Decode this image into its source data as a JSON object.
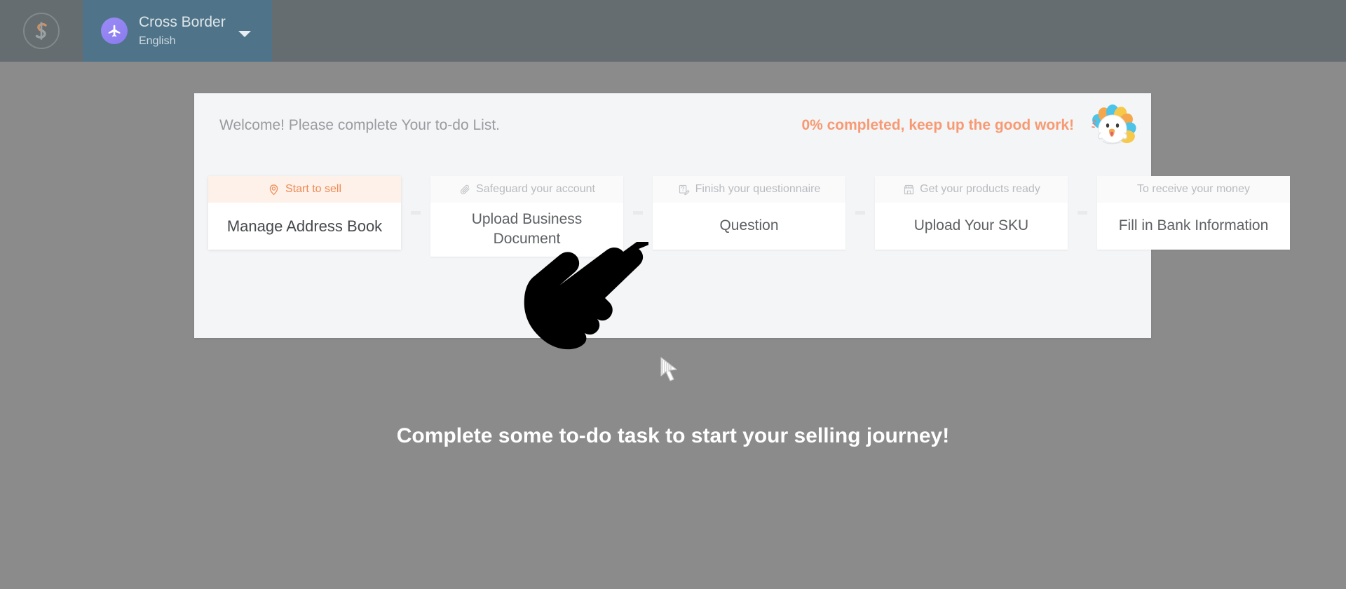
{
  "topbar": {
    "logo_icon": "s-logo-icon",
    "brand": {
      "avatar_icon": "airplane-icon",
      "name": "Cross Border",
      "language": "English",
      "caret_icon": "chevron-down-icon"
    }
  },
  "panel": {
    "welcome": "Welcome! Please complete Your to-do List.",
    "progress": "0% completed, keep up the good work!",
    "mascot_icon": "chick-mascot-icon",
    "progress_color": "#f79a73",
    "cards": [
      {
        "header": "Start to sell",
        "icon": "location-pin-icon",
        "title": "Manage Address Book",
        "active": true
      },
      {
        "header": "Safeguard your account",
        "icon": "paperclip-icon",
        "title": "Upload Business Document",
        "active": false
      },
      {
        "header": "Finish your questionnaire",
        "icon": "questionnaire-icon",
        "title": "Question",
        "active": false
      },
      {
        "header": "Get your products ready",
        "icon": "storefront-icon",
        "title": "Upload Your SKU",
        "active": false
      },
      {
        "header": "To receive your money",
        "icon": "",
        "title": "Fill in Bank Information",
        "active": false
      }
    ]
  },
  "message": {
    "journey": "Complete some to-do task to start your selling journey!"
  },
  "overlays": {
    "hand_icon": "pointing-hand-icon",
    "cursor_icon": "mouse-arrow-cursor"
  }
}
